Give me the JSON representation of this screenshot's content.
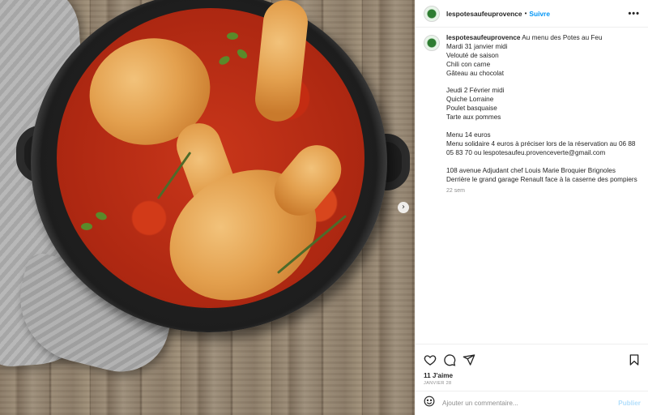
{
  "post": {
    "username": "lespotesaufeuprovence",
    "follow_label": "Suivre",
    "more_label": "•••"
  },
  "caption": {
    "username": "lespotesaufeuprovence",
    "first_line": "Au menu des Potes au Feu",
    "lines": [
      "Mardi 31 janvier midi",
      "Velouté de saison",
      "Chili con carne",
      "Gâteau au chocolat",
      "",
      "Jeudi 2 Février midi",
      "Quiche Lorraine",
      "Poulet basquaise",
      "Tarte aux pommes",
      "",
      "Menu 14 euros",
      "Menu solidaire 4 euros à préciser lors de la réservation au 06 88 05 83 70 ou lespotesaufeu.provenceverte@gmail.com",
      "",
      "108 avenue Adjudant chef Louis Marie Broquier Brignoles",
      "Derrière le grand garage Renault face à la caserne des pompiers"
    ],
    "time": "22 sem"
  },
  "stats": {
    "likes": "11 J'aime",
    "date": "JANVIER 28"
  },
  "comment": {
    "placeholder": "Ajouter un commentaire...",
    "publish_label": "Publier"
  },
  "icons": {
    "like": "heart-icon",
    "comment": "comment-icon",
    "share": "send-icon",
    "save": "bookmark-icon",
    "emoji": "emoji-icon",
    "carousel": "chevron-right-icon"
  },
  "colors": {
    "accent": "#0095f6",
    "publish_disabled": "#b2dffc",
    "muted": "#8e8e8e"
  }
}
